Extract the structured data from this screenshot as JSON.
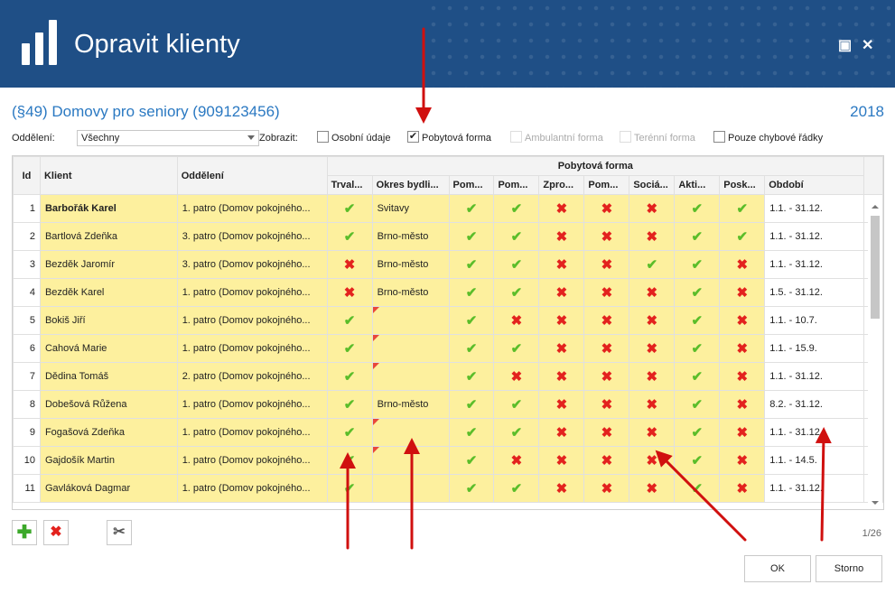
{
  "window": {
    "title": "Opravit klienty",
    "maximize_glyph": "▣",
    "close_glyph": "✕"
  },
  "header": {
    "subtitle": "(§49) Domovy pro seniory (909123456)",
    "year": "2018"
  },
  "filter": {
    "department_label": "Oddělení:",
    "department_value": "Všechny",
    "show_label": "Zobrazit:",
    "options": [
      {
        "label": "Osobní údaje",
        "checked": false,
        "enabled": true
      },
      {
        "label": "Pobytová forma",
        "checked": true,
        "enabled": true
      },
      {
        "label": "Ambulantní forma",
        "checked": false,
        "enabled": false
      },
      {
        "label": "Terénní forma",
        "checked": false,
        "enabled": false
      },
      {
        "label": "Pouze chybové řádky",
        "checked": false,
        "enabled": true
      }
    ]
  },
  "grid": {
    "group_header": "Pobytová forma",
    "columns": [
      "Id",
      "Klient",
      "Oddělení",
      "Trval...",
      "Okres bydli...",
      "Pom...",
      "Pom...",
      "Zpro...",
      "Pom...",
      "Sociá...",
      "Akti...",
      "Posk...",
      "Období"
    ],
    "rows": [
      {
        "id": "1",
        "klient": "Barbořák Karel",
        "oddeleni": "1. patro (Domov pokojného...",
        "okres": "Svitavy",
        "flags": [
          1,
          1,
          1,
          0,
          0,
          0,
          1,
          1
        ],
        "obdobi": "1.1. - 31.12."
      },
      {
        "id": "2",
        "klient": "Bartlová Zdeňka",
        "oddeleni": "3. patro (Domov pokojného...",
        "okres": "Brno-město",
        "flags": [
          1,
          1,
          1,
          0,
          0,
          0,
          1,
          1
        ],
        "obdobi": "1.1. - 31.12."
      },
      {
        "id": "3",
        "klient": "Bezděk Jaromír",
        "oddeleni": "3. patro (Domov pokojného...",
        "okres": "Brno-město",
        "flags": [
          0,
          1,
          1,
          0,
          0,
          1,
          1,
          0
        ],
        "obdobi": "1.1. - 31.12."
      },
      {
        "id": "4",
        "klient": "Bezděk Karel",
        "oddeleni": "1. patro (Domov pokojného...",
        "okres": "Brno-město",
        "flags": [
          0,
          1,
          1,
          0,
          0,
          0,
          1,
          0
        ],
        "obdobi": "1.5. - 31.12."
      },
      {
        "id": "5",
        "klient": "Bokiš Jiří",
        "oddeleni": "1. patro (Domov pokojného...",
        "okres": "",
        "flags": [
          1,
          1,
          0,
          0,
          0,
          0,
          1,
          0
        ],
        "obdobi": "1.1. - 10.7."
      },
      {
        "id": "6",
        "klient": "Cahová Marie",
        "oddeleni": "1. patro (Domov pokojného...",
        "okres": "",
        "flags": [
          1,
          1,
          1,
          0,
          0,
          0,
          1,
          0
        ],
        "obdobi": "1.1. - 15.9."
      },
      {
        "id": "7",
        "klient": "Dědina Tomáš",
        "oddeleni": "2. patro (Domov pokojného...",
        "okres": "",
        "flags": [
          1,
          1,
          0,
          0,
          0,
          0,
          1,
          0
        ],
        "obdobi": "1.1. - 31.12."
      },
      {
        "id": "8",
        "klient": "Dobešová Růžena",
        "oddeleni": "1. patro (Domov pokojného...",
        "okres": "Brno-město",
        "flags": [
          1,
          1,
          1,
          0,
          0,
          0,
          1,
          0
        ],
        "obdobi": "8.2. - 31.12."
      },
      {
        "id": "9",
        "klient": "Fogašová Zdeňka",
        "oddeleni": "1. patro (Domov pokojného...",
        "okres": "",
        "flags": [
          1,
          1,
          1,
          0,
          0,
          0,
          1,
          0
        ],
        "obdobi": "1.1. - 31.12."
      },
      {
        "id": "10",
        "klient": "Gajdošík Martin",
        "oddeleni": "1. patro (Domov pokojného...",
        "okres": "",
        "flags": [
          1,
          1,
          0,
          0,
          0,
          0,
          1,
          0
        ],
        "obdobi": "1.1. - 14.5."
      },
      {
        "id": "11",
        "klient": "Gavláková Dagmar",
        "oddeleni": "1. patro (Domov pokojného...",
        "okres": "",
        "flags": [
          1,
          1,
          1,
          0,
          0,
          0,
          1,
          0
        ],
        "obdobi": "1.1. - 31.12."
      }
    ],
    "selected_row": 0,
    "flagged_okres_rows": [
      4,
      5,
      6,
      8,
      9
    ]
  },
  "toolbar": {
    "add_glyph": "✚",
    "delete_glyph": "✖",
    "settings_glyph": "✂"
  },
  "pager": {
    "text": "1/26"
  },
  "buttons": {
    "ok": "OK",
    "cancel": "Storno"
  },
  "icons": {
    "check": "✔",
    "cross": "✖"
  },
  "colors": {
    "titlebar": "#1f4f86",
    "accent": "#2b79c2",
    "highlight": "#fdf09e",
    "ok": "#5bbd2a",
    "error": "#e3221e",
    "annotation": "#d0100f"
  }
}
